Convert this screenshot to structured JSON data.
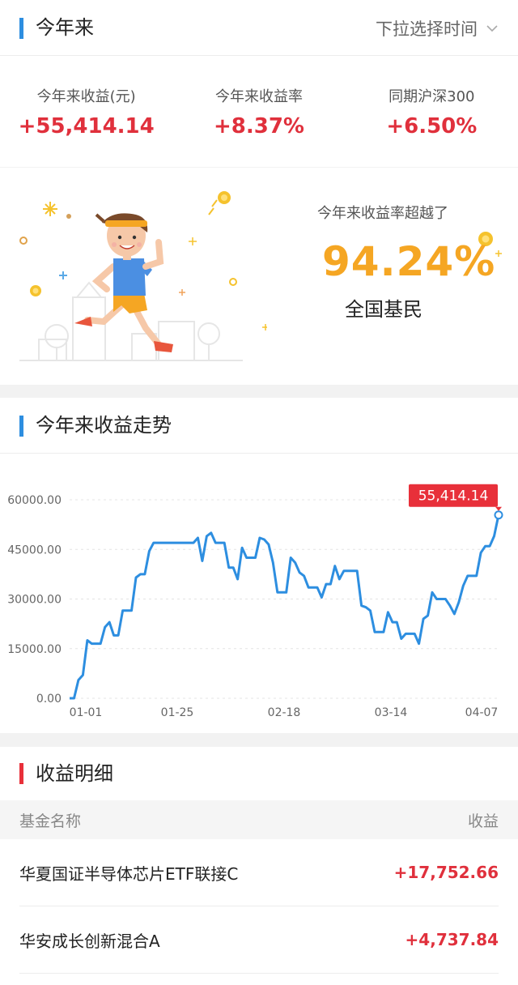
{
  "ytd": {
    "title": "今年来",
    "dropdown_label": "下拉选择时间",
    "stats": [
      {
        "label": "今年来收益(元)",
        "value": "+55,414.14"
      },
      {
        "label": "今年来收益率",
        "value": "+8.37%"
      },
      {
        "label": "同期沪深300",
        "value": "+6.50%"
      }
    ]
  },
  "rank": {
    "caption": "今年来收益率超越了",
    "percent": "94.24%",
    "subject": "全国基民"
  },
  "trend": {
    "title": "今年来收益走势",
    "last_value_label": "55,414.14"
  },
  "chart_data": {
    "type": "line",
    "y_ticks": [
      "60000.00",
      "45000.00",
      "30000.00",
      "15000.00",
      "0.00"
    ],
    "x_ticks": [
      "01-01",
      "01-25",
      "02-18",
      "03-14",
      "04-07"
    ],
    "ylim": [
      0,
      60000
    ],
    "series": [
      {
        "color": "#2d8ee0",
        "values": [
          0,
          0,
          5500,
          7000,
          17500,
          16500,
          16500,
          16500,
          21500,
          23000,
          19000,
          19000,
          26500,
          26500,
          26500,
          36500,
          37500,
          37500,
          44500,
          47000,
          47000,
          47000,
          47000,
          47000,
          47000,
          47000,
          47000,
          47000,
          47000,
          48500,
          41500,
          49000,
          50000,
          47000,
          47000,
          47000,
          39500,
          39500,
          36000,
          45500,
          42500,
          42500,
          42500,
          48500,
          48000,
          46500,
          41000,
          32000,
          32000,
          32000,
          42500,
          41000,
          38000,
          37000,
          33500,
          33500,
          33500,
          30500,
          34500,
          34500,
          40000,
          36000,
          38500,
          38500,
          38500,
          38500,
          28000,
          27500,
          26500,
          20000,
          20000,
          20000,
          26000,
          23000,
          23000,
          18000,
          19500,
          19500,
          19500,
          16500,
          24000,
          25000,
          32000,
          30000,
          30000,
          30000,
          28000,
          25500,
          29000,
          34000,
          37000,
          37000,
          37000,
          44000,
          46000,
          46000,
          49000,
          55414
        ]
      }
    ]
  },
  "detail": {
    "title": "收益明细",
    "col_name": "基金名称",
    "col_value": "收益",
    "rows": [
      {
        "name": "华夏国证半导体芯片ETF联接C",
        "value": "+17,752.66"
      },
      {
        "name": "华安成长创新混合A",
        "value": "+4,737.84"
      }
    ]
  },
  "colors": {
    "accent": "#2d8ee0",
    "up": "#e0303c",
    "rank": "#f5a623",
    "tag_bg": "#e8303a"
  }
}
